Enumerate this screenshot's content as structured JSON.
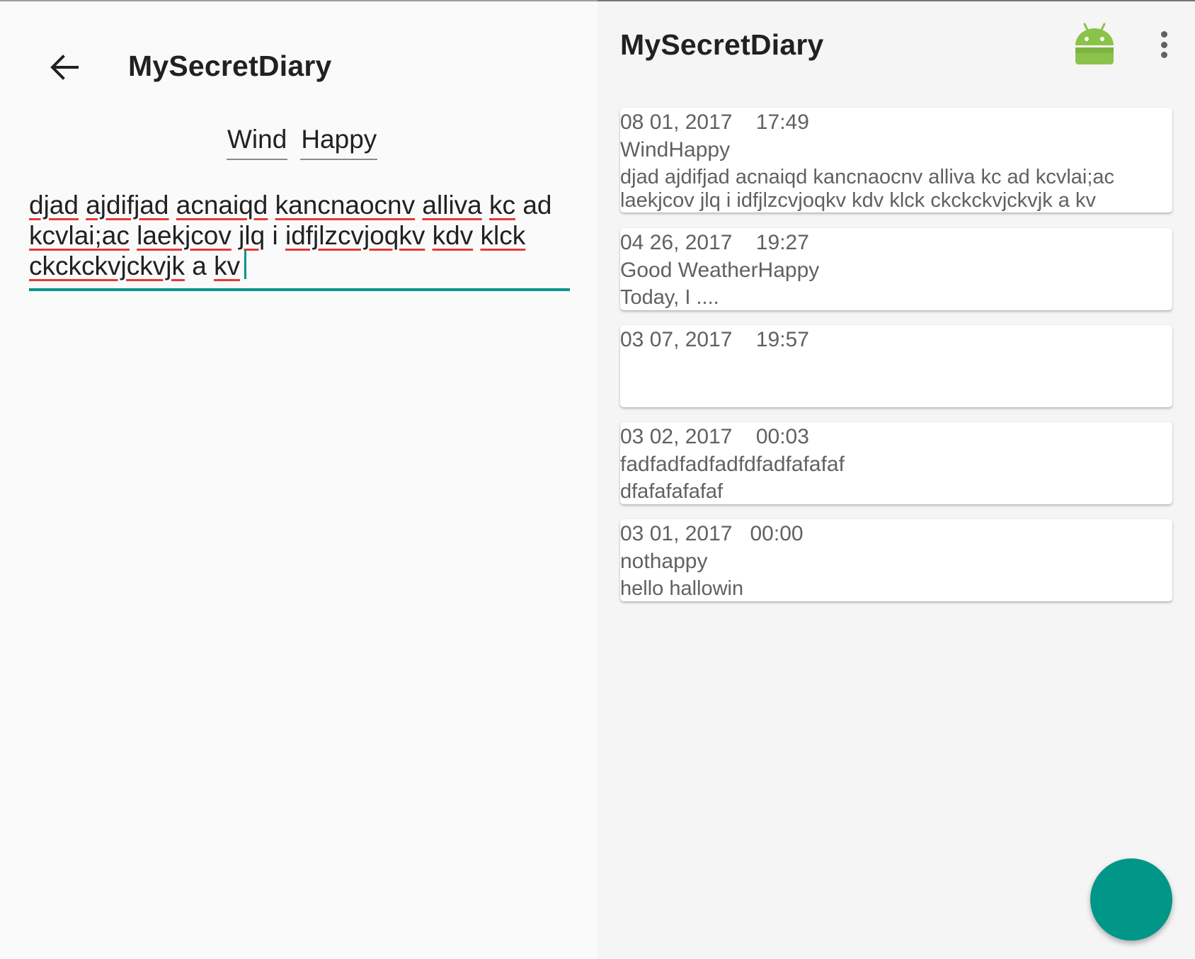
{
  "editor": {
    "app_title": "MySecretDiary",
    "tags": [
      "Wind",
      "Happy"
    ],
    "content_words": [
      "djad",
      "ajdifjad",
      "acnaiqd",
      "kancnaocnv",
      "alliva",
      "kc",
      "ad",
      "kcvlai;ac",
      "laekjcov",
      "jlq",
      "i",
      "idfjlzcvjoqkv",
      "kdv",
      "klck",
      "ckckckvjckvjk",
      "a",
      "kv"
    ],
    "misspelled": [
      "djad",
      "ajdifjad",
      "acnaiqd",
      "kancnaocnv",
      "alliva",
      "kc",
      "kcvlai;ac",
      "laekjcov",
      "jlq",
      "idfjlzcvjoqkv",
      "kdv",
      "klck",
      "ckckckvjckvjk",
      "kv"
    ],
    "accent_color": "#009688",
    "spellcheck_color": "#e53935"
  },
  "list": {
    "app_title": "MySecretDiary",
    "toolbar_icons": [
      "android-icon",
      "more-vert-icon"
    ],
    "entries": [
      {
        "date": "08 01, 2017    17:49",
        "title": "WindHappy",
        "body": "djad ajdifjad acnaiqd kancnaocnv alliva kc ad kcvlai;ac laekjcov jlq i idfjlzcvjoqkv kdv klck ckckckvjckvjk a kv"
      },
      {
        "date": "04 26, 2017    19:27",
        "title": "Good WeatherHappy",
        "body": "Today, I ...."
      },
      {
        "date": "03 07, 2017    19:57",
        "title": "",
        "body": ""
      },
      {
        "date": "03 02, 2017    00:03",
        "title": "fadfadfadfadfdfadfafafaf",
        "body": "dfafafafafaf"
      },
      {
        "date": "03 01, 2017   00:00",
        "title": "nothappy",
        "body": "hello hallowin"
      }
    ],
    "fab_color": "#009688"
  }
}
